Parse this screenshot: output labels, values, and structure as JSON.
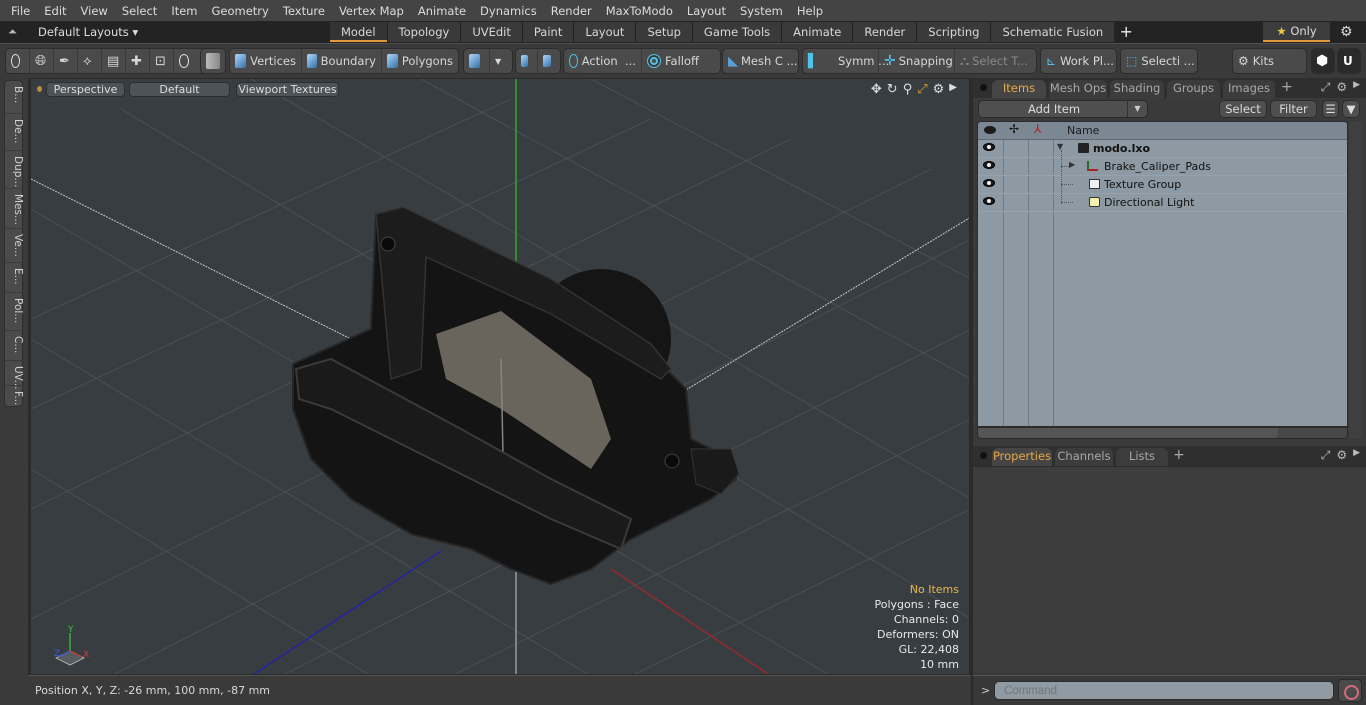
{
  "menu": [
    "File",
    "Edit",
    "View",
    "Select",
    "Item",
    "Geometry",
    "Texture",
    "Vertex Map",
    "Animate",
    "Dynamics",
    "Render",
    "MaxToModo",
    "Layout",
    "System",
    "Help"
  ],
  "layout_bar": {
    "layouts_label": "Default Layouts ▾",
    "tabs": [
      "Model",
      "Topology",
      "UVEdit",
      "Paint",
      "Layout",
      "Setup",
      "Game Tools",
      "Animate",
      "Render",
      "Scripting",
      "Schematic Fusion"
    ],
    "active_tab": "Model",
    "add_tab": "+",
    "only_label": "Only",
    "only_icon": "star-icon"
  },
  "toolbar": {
    "vertices": "Vertices",
    "boundary": "Boundary",
    "polygons": "Polygons",
    "action": "Action",
    "action_more": "...",
    "falloff": "Falloff",
    "mesh_c": "Mesh C ...",
    "symm": "Symm ...",
    "snapping": "Snapping",
    "select_t": "Select T...",
    "work_pl": "Work Pl...",
    "selecti": "Selecti ...",
    "kits": "Kits"
  },
  "left_tabs": [
    "B...",
    "De...",
    "Dup...",
    "Mes...",
    "Ve...",
    "E...",
    "Pol...",
    "C...",
    "UV...",
    "F..."
  ],
  "viewport": {
    "view_mode": "Perspective",
    "shading": "Default",
    "textures": "Viewport Textures",
    "hud": {
      "selection": "No Items",
      "polygons": "Polygons : Face",
      "channels": "Channels: 0",
      "deformers": "Deformers: ON",
      "gl": "GL: 22,408",
      "scale": "10 mm"
    },
    "axis_labels": {
      "x": "X",
      "y": "Y",
      "z": "Z"
    },
    "colors": {
      "x_axis": "#b03030",
      "y_axis": "#30c030",
      "z_axis": "#2020b0"
    }
  },
  "items_panel": {
    "tabs": [
      "Items",
      "Mesh Ops",
      "Shading",
      "Groups",
      "Images"
    ],
    "active_tab": "Items",
    "add_item": "Add Item",
    "select_btn": "Select",
    "filter_btn": "Filter",
    "column_name": "Name",
    "items": [
      {
        "name": "modo.lxo",
        "level": 0,
        "bold": true,
        "icon": "scene-icon",
        "expanded": true
      },
      {
        "name": "Brake_Caliper_Pads",
        "level": 1,
        "bold": false,
        "icon": "mesh-locator-icon",
        "expandable": true
      },
      {
        "name": "Texture Group",
        "level": 1,
        "bold": false,
        "icon": "folder-icon"
      },
      {
        "name": "Directional Light",
        "level": 1,
        "bold": false,
        "icon": "light-icon"
      }
    ]
  },
  "properties_panel": {
    "tabs": [
      "Properties",
      "Channels",
      "Lists"
    ],
    "active_tab": "Properties"
  },
  "status": {
    "position": "Position X, Y, Z:   -26 mm, 100 mm, -87 mm"
  },
  "command": {
    "prompt": ">",
    "placeholder": "Command"
  },
  "accent_color": "#e09a3c"
}
